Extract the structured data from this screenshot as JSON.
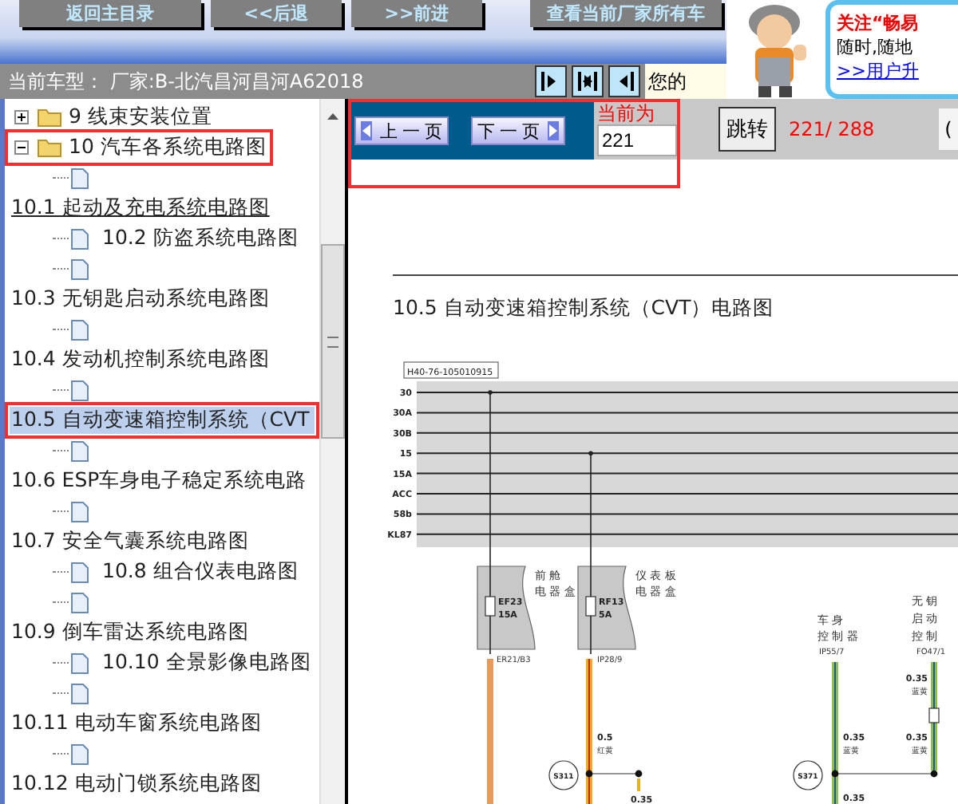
{
  "top_buttons": [
    "返回主目录",
    "<<后退",
    ">>前进",
    "查看当前厂家所有车"
  ],
  "model_bar": {
    "text": "当前车型：  厂家:B-北汽昌河昌河A62018",
    "nav_buttons": [
      {
        "kind": "right"
      },
      {
        "kind": "both"
      },
      {
        "kind": "left"
      }
    ],
    "note": "您的"
  },
  "ad": {
    "line_1": "关注“畅易",
    "line_2": "随时,随地",
    "link": ">>用户升"
  },
  "tree": [
    {
      "kind": "folder",
      "label": "9 线束安装位置",
      "expanded": false,
      "highlighted": false
    },
    {
      "kind": "folder",
      "label": "10 汽车各系统电路图",
      "expanded": true,
      "highlighted": true,
      "children": [
        {
          "kind": "leaf"
        },
        {
          "kind": "topic",
          "label": "10.1 起动及充电系统电路图",
          "selected": false,
          "hovered": true,
          "highlighted": false
        },
        {
          "kind": "leaf",
          "label": "10.2 防盗系统电路图"
        },
        {
          "kind": "leaf"
        },
        {
          "kind": "topic",
          "label": "10.3 无钥匙启动系统电路图",
          "selected": false,
          "hovered": false,
          "highlighted": false
        },
        {
          "kind": "leaf"
        },
        {
          "kind": "topic",
          "label": "10.4 发动机控制系统电路图",
          "selected": false,
          "hovered": false,
          "highlighted": false
        },
        {
          "kind": "leaf"
        },
        {
          "kind": "topic",
          "label": "10.5 自动变速箱控制系统（CVT",
          "selected": true,
          "hovered": false,
          "highlighted": true
        },
        {
          "kind": "leaf"
        },
        {
          "kind": "topic",
          "label": "10.6 ESP车身电子稳定系统电路",
          "selected": false,
          "hovered": false,
          "highlighted": false
        },
        {
          "kind": "leaf"
        },
        {
          "kind": "topic",
          "label": "10.7 安全气囊系统电路图",
          "selected": false,
          "hovered": false,
          "highlighted": false
        },
        {
          "kind": "leaf",
          "label": "10.8 组合仪表电路图"
        },
        {
          "kind": "leaf"
        },
        {
          "kind": "topic",
          "label": "10.9 倒车雷达系统电路图",
          "selected": false,
          "hovered": false,
          "highlighted": false
        },
        {
          "kind": "leaf",
          "label": "10.10 全景影像电路图"
        },
        {
          "kind": "leaf"
        },
        {
          "kind": "topic",
          "label": "10.11 电动车窗系统电路图",
          "selected": false,
          "hovered": false,
          "highlighted": false
        },
        {
          "kind": "leaf"
        },
        {
          "kind": "topic",
          "label": "10.12 电动门锁系统电路图",
          "selected": false,
          "hovered": false,
          "highlighted": false
        }
      ]
    }
  ],
  "pager": {
    "highlighted": true,
    "prev": "上 一 页",
    "next": "下 一 页",
    "current_label": "当前为",
    "current_value": "221",
    "jump": "跳转",
    "count": "221/ 288",
    "cut": "("
  },
  "document": {
    "title": "10.5  自动变速箱控制系统（CVT）电路图",
    "diagram": {
      "code": "H40-76-105010915",
      "bus_labels": [
        "30",
        "30A",
        "30B",
        "15",
        "15A",
        "ACC",
        "58b",
        "KL87"
      ],
      "fuse_boxes": [
        {
          "name": [
            "前 舱",
            "电 器 盒"
          ],
          "fuse": "EF23",
          "rating": "15A",
          "pin": "ER21/B3"
        },
        {
          "name": [
            "仪 表 板",
            "电 器 盒"
          ],
          "fuse": "RF13",
          "rating": "5A",
          "pin": "IP28/9"
        }
      ],
      "wire_1": {
        "size": "0.5",
        "marking": "红黄",
        "splice": "S311",
        "branch": "0.35"
      },
      "module_1": {
        "name": [
          "车 身",
          "控 制 器"
        ],
        "pin": "IP55/7",
        "size": "0.35",
        "marking": "蓝黄",
        "splice": "S371",
        "branch": "0.35"
      },
      "module_2": {
        "name": [
          "无 钥",
          "启 动",
          "控 制"
        ],
        "pin": "FO47/1",
        "size_1": "0.35",
        "marking_1": "蓝黄",
        "size_2": "0.35",
        "marking_2": "蓝黄"
      }
    }
  }
}
